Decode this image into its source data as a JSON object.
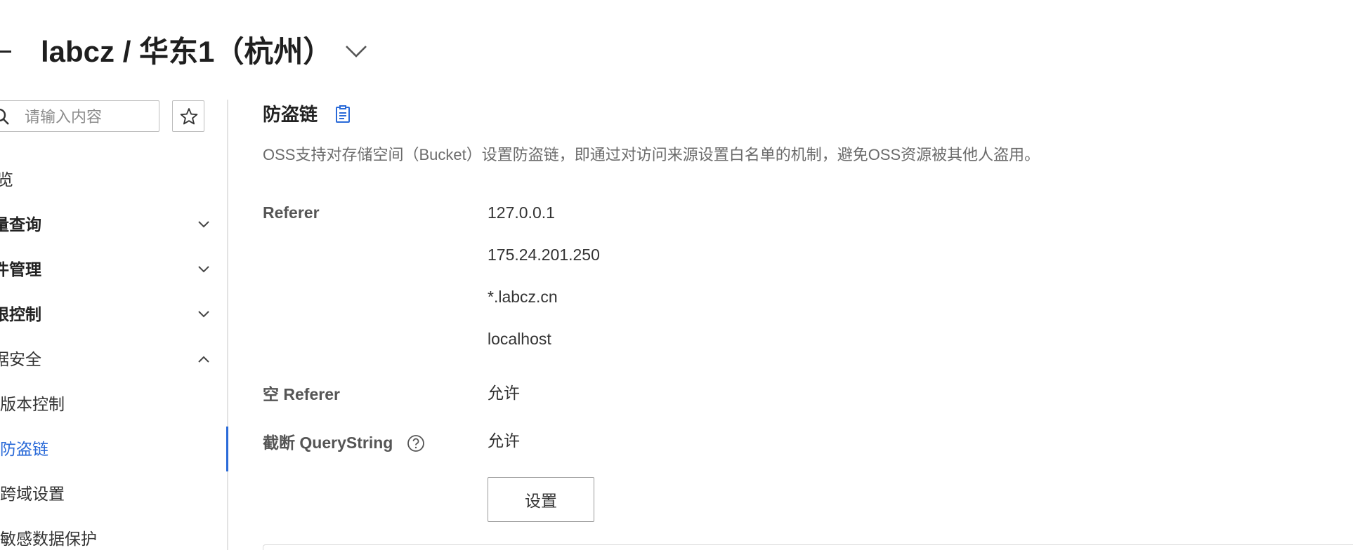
{
  "header": {
    "title": "labcz / 华东1（杭州）"
  },
  "search": {
    "placeholder": "请输入内容",
    "value": ""
  },
  "sidebar": {
    "items": [
      {
        "label": "览"
      },
      {
        "label": "量查询"
      },
      {
        "label": "件管理"
      },
      {
        "label": "限控制"
      },
      {
        "label": "据安全"
      },
      {
        "label": "版本控制"
      },
      {
        "label": "防盗链"
      },
      {
        "label": "跨域设置"
      },
      {
        "label": "敏感数据保护"
      }
    ]
  },
  "main": {
    "section_title": "防盗链",
    "description": "OSS支持对存储空间（Bucket）设置防盗链，即通过对访问来源设置白名单的机制，避免OSS资源被其他人盗用。",
    "referer_label": "Referer",
    "referer_values": [
      "127.0.0.1",
      "175.24.201.250",
      "*.labcz.cn",
      "localhost"
    ],
    "empty_referer_label": "空 Referer",
    "empty_referer_value": "允许",
    "truncate_label": "截断 QueryString",
    "truncate_value": "允许",
    "settings_button": "设置"
  },
  "colors": {
    "accent": "#2a6ad8",
    "text": "#333333",
    "muted": "#6b6b6b",
    "border": "#bdbdbd"
  }
}
